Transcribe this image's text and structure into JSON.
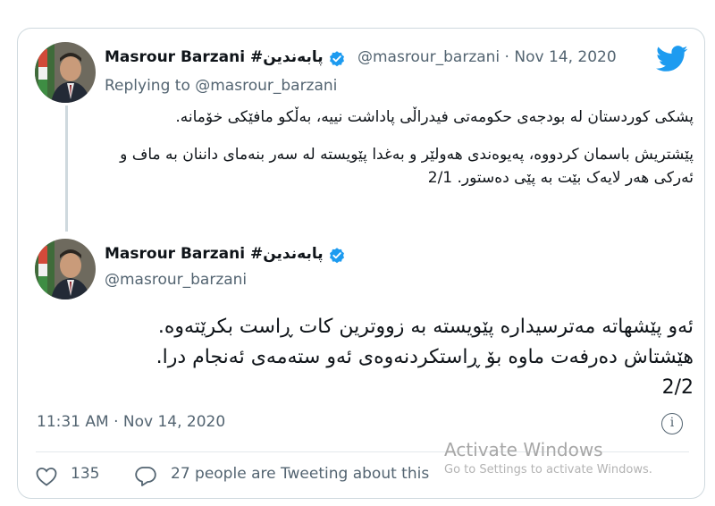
{
  "colors": {
    "brand_blue": "#1d9bf0",
    "secondary_text": "#536471",
    "border": "#cfd9de"
  },
  "parent_tweet": {
    "author_name": "Masrour Barzani #پابەندین",
    "handle": "@masrour_barzani",
    "date": " · Nov 14, 2020",
    "replying_to": "Replying to @masrour_barzani",
    "paragraph1": "پشکی کوردستان لە بودجەی حکومەتی فیدراڵی پاداشت نییە، بەڵکو مافێکی خۆمانە.",
    "paragraph2": "پێشتریش باسمان کردووە، پەیوەندی هەولێر و بەغدا پێویستە لە سەر بنەمای داننان بە ماف و ئەرکی هەر لایەک بێت بە پێی دەستور. 2/1"
  },
  "main_tweet": {
    "author_name": "Masrour Barzani #پابەندین",
    "handle": "@masrour_barzani",
    "text_line1": "ئەو پێشهاتە مەترسیدارە پێویستە بە زووترین کات ڕاست بکرێتەوە.",
    "text_line2": "هێشتاش دەرفەت ماوە بۆ ڕاستکردنەوەی ئەو ستەمەی ئەنجام درا.",
    "text_line3": "2/2",
    "timestamp": "11:31 AM · Nov 14, 2020",
    "likes": "135",
    "replies_text": "27 people are Tweeting about this"
  },
  "icons": {
    "verified": "verified-badge-icon",
    "bird": "twitter-bird-icon",
    "info": "info-icon",
    "heart": "heart-icon",
    "comment": "comment-icon"
  },
  "watermark": {
    "title": "Activate Windows",
    "subtitle": "Go to Settings to activate Windows."
  }
}
